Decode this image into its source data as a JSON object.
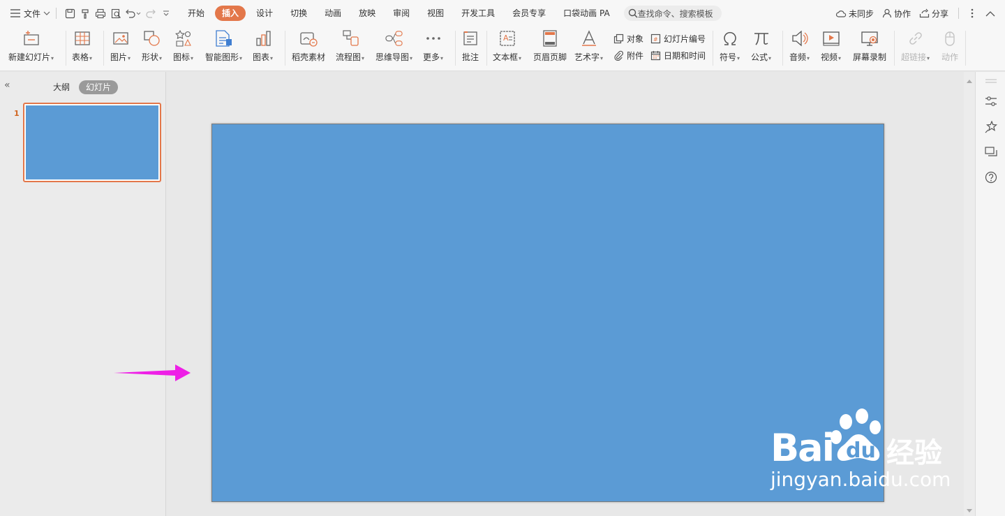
{
  "menubar": {
    "file_label": "文件",
    "tabs": [
      "开始",
      "插入",
      "设计",
      "切换",
      "动画",
      "放映",
      "审阅",
      "视图",
      "开发工具",
      "会员专享",
      "口袋动画 PA"
    ],
    "active_tab": "插入",
    "search_placeholder": "查找命令、搜索模板",
    "sync_label": "未同步",
    "collab_label": "协作",
    "share_label": "分享"
  },
  "ribbon": {
    "new_slide": "新建幻灯片",
    "table": "表格",
    "picture": "图片",
    "shape": "形状",
    "icon": "图标",
    "smartart": "智能图形",
    "chart": "图表",
    "material": "稻壳素材",
    "flowchart": "流程图",
    "mindmap": "思维导图",
    "more": "更多",
    "comment": "批注",
    "textbox": "文本框",
    "header_footer": "页眉页脚",
    "wordart": "艺术字",
    "object": "对象",
    "attachment": "附件",
    "slide_number": "幻灯片编号",
    "datetime": "日期和时间",
    "symbol": "符号",
    "formula": "公式",
    "audio": "音频",
    "video": "视频",
    "screen_record": "屏幕录制",
    "hyperlink": "超链接",
    "action": "动作"
  },
  "leftpane": {
    "tab_outline": "大纲",
    "tab_slides": "幻灯片",
    "slide_number": "1"
  },
  "slide": {
    "fill_color": "#5b9bd5"
  },
  "watermark": {
    "text_bai": "Bai",
    "text_du": "du",
    "text_jingyan": "经验",
    "url": "jingyan.baidu.com"
  },
  "colors": {
    "accent": "#e3774a",
    "annotation_arrow": "#ee1fe6"
  }
}
